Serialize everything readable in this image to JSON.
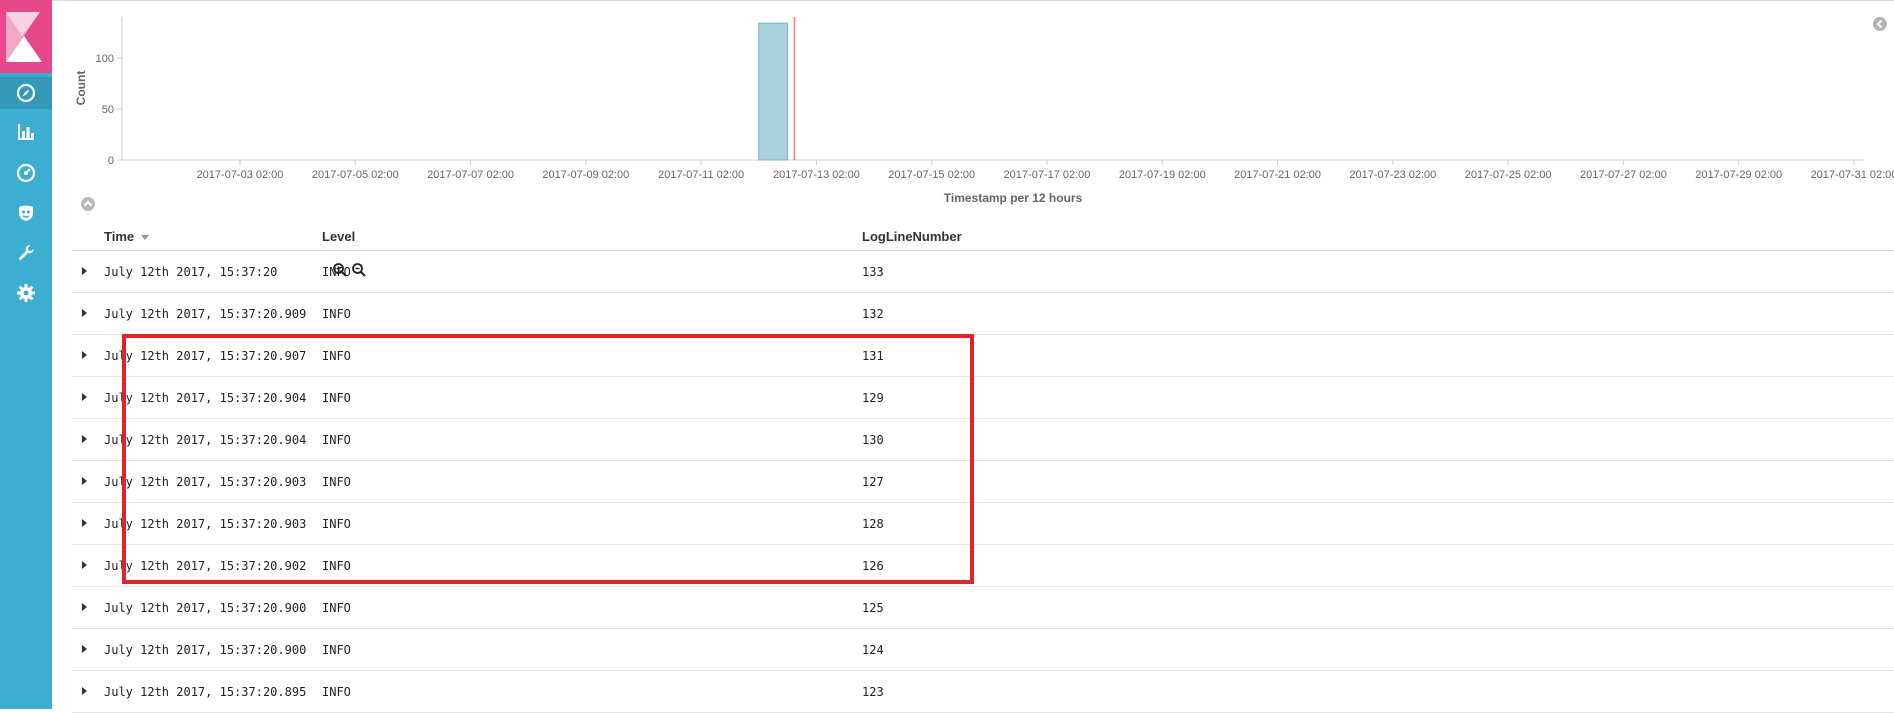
{
  "sidebar": {
    "items": [
      {
        "icon": "compass-icon",
        "active": true
      },
      {
        "icon": "bar-chart-icon",
        "active": false
      },
      {
        "icon": "gauge-icon",
        "active": false
      },
      {
        "icon": "shield-face-icon",
        "active": false
      },
      {
        "icon": "wrench-icon",
        "active": false
      },
      {
        "icon": "gear-icon",
        "active": false
      }
    ]
  },
  "chart_data": {
    "type": "bar",
    "ylabel": "Count",
    "xlabel": "Timestamp per 12 hours",
    "ylim": [
      0,
      140
    ],
    "y_ticks": [
      "0",
      "50",
      "100"
    ],
    "y_tick_values": [
      0,
      50,
      100
    ],
    "x_ticks": [
      "2017-07-03 02:00",
      "2017-07-05 02:00",
      "2017-07-07 02:00",
      "2017-07-09 02:00",
      "2017-07-11 02:00",
      "2017-07-13 02:00",
      "2017-07-15 02:00",
      "2017-07-17 02:00",
      "2017-07-19 02:00",
      "2017-07-21 02:00",
      "2017-07-23 02:00",
      "2017-07-25 02:00",
      "2017-07-27 02:00",
      "2017-07-29 02:00",
      "2017-07-31 02:00"
    ],
    "bars": [
      {
        "x": "2017-07-12 14:00",
        "value": 134
      }
    ],
    "marker_line": "2017-07-13 02:00",
    "colors": {
      "bar": "#a8d1de",
      "bar_stroke": "#7fb3c6",
      "marker": "#f08080",
      "axis": "#d0d0d0",
      "text": "#666666"
    }
  },
  "table": {
    "headers": {
      "time": "Time",
      "level": "Level",
      "log_line": "LogLineNumber"
    },
    "rows": [
      {
        "time": "July 12th 2017, 15:37:20",
        "level": "INFO",
        "log_line": "133"
      },
      {
        "time": "July 12th 2017, 15:37:20.909",
        "level": "INFO",
        "log_line": "132"
      },
      {
        "time": "July 12th 2017, 15:37:20.907",
        "level": "INFO",
        "log_line": "131"
      },
      {
        "time": "July 12th 2017, 15:37:20.904",
        "level": "INFO",
        "log_line": "129"
      },
      {
        "time": "July 12th 2017, 15:37:20.904",
        "level": "INFO",
        "log_line": "130"
      },
      {
        "time": "July 12th 2017, 15:37:20.903",
        "level": "INFO",
        "log_line": "127"
      },
      {
        "time": "July 12th 2017, 15:37:20.903",
        "level": "INFO",
        "log_line": "128"
      },
      {
        "time": "July 12th 2017, 15:37:20.902",
        "level": "INFO",
        "log_line": "126"
      },
      {
        "time": "July 12th 2017, 15:37:20.900",
        "level": "INFO",
        "log_line": "125"
      },
      {
        "time": "July 12th 2017, 15:37:20.900",
        "level": "INFO",
        "log_line": "124"
      },
      {
        "time": "July 12th 2017, 15:37:20.895",
        "level": "INFO",
        "log_line": "123"
      }
    ]
  },
  "highlight_color": "#e02428"
}
